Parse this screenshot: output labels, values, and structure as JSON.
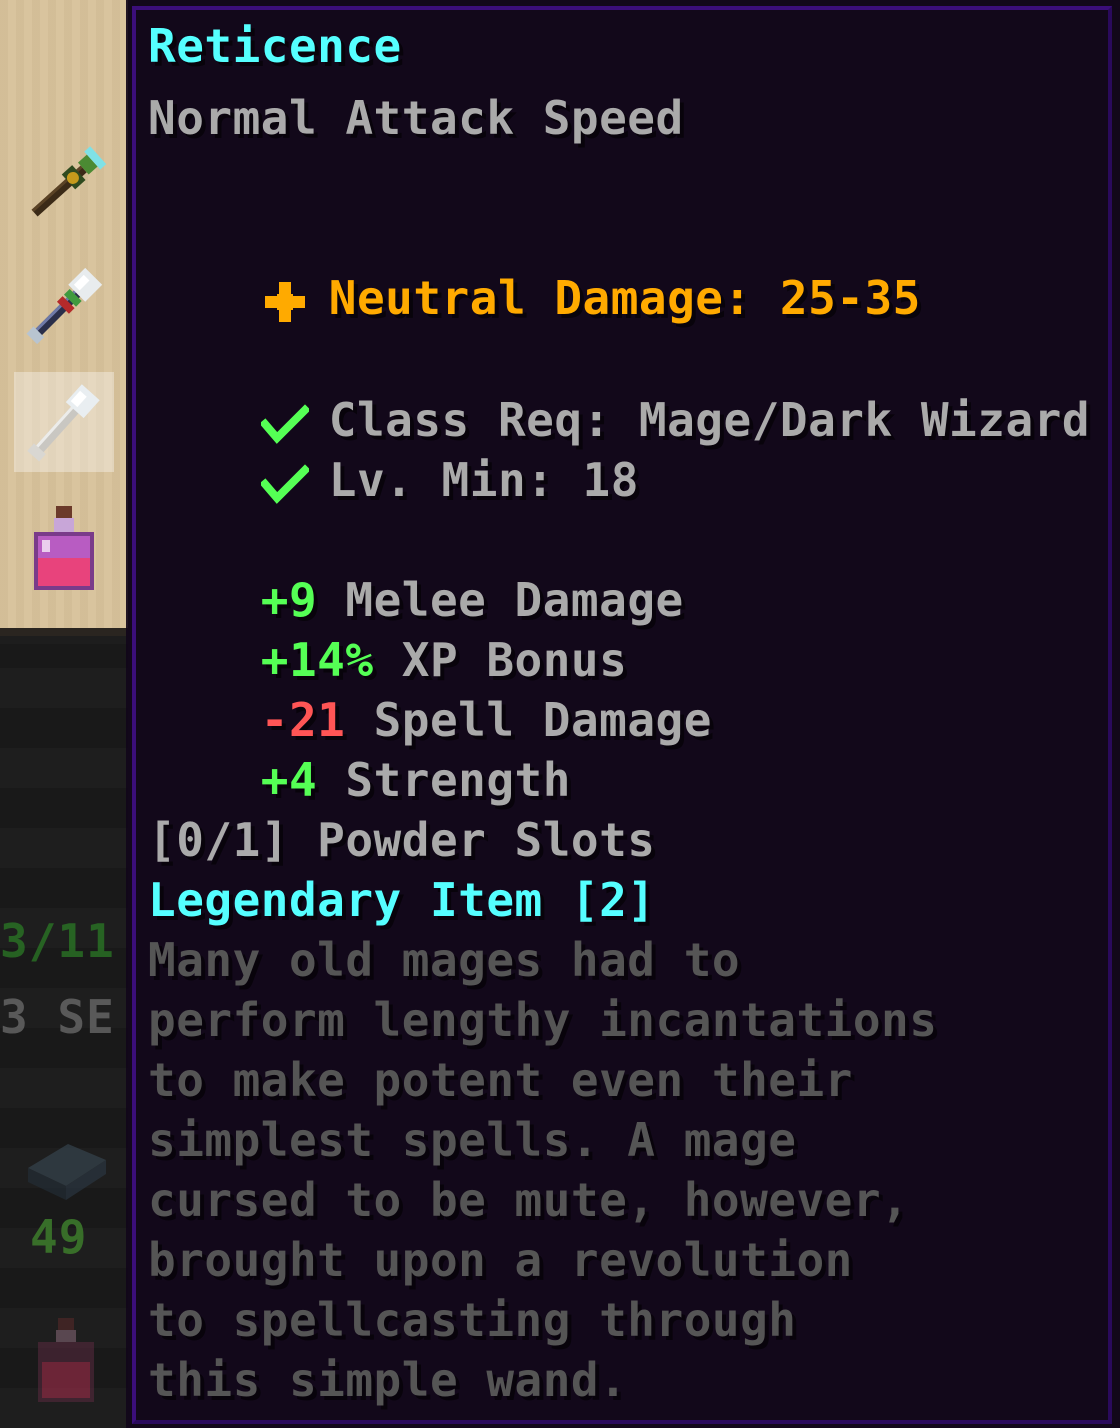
{
  "inventory": {
    "side_count": "3/11",
    "side_direction": "3 SE",
    "side_number": "49"
  },
  "item": {
    "name": "Reticence",
    "attack_speed": "Normal Attack Speed",
    "damage_label": "Neutral Damage: 25-35",
    "requirements": [
      {
        "text": "Class Req: Mage/Dark Wizard",
        "met": true
      },
      {
        "text": "Lv. Min: 18",
        "met": true
      }
    ],
    "identifications": [
      {
        "value": "+9",
        "label": "Melee Damage",
        "positive": true
      },
      {
        "value": "+14%",
        "label": "XP Bonus",
        "positive": true
      },
      {
        "value": "-21",
        "label": "Spell Damage",
        "positive": false
      },
      {
        "value": "+4",
        "label": "Strength",
        "positive": true
      }
    ],
    "powder_slots": "[0/1] Powder Slots",
    "rarity": "Legendary Item [2]",
    "lore": [
      "Many old mages had to",
      "perform lengthy incantations",
      "to make potent even their",
      "simplest spells. A mage",
      "cursed to be mute, however,",
      "brought upon a revolution",
      "to spellcasting through",
      "this simple wand."
    ]
  },
  "colors": {
    "name": "#55ffff",
    "damage": "#ffaa00",
    "positive": "#55ff55",
    "negative": "#ff5555",
    "lore": "#555555",
    "tooltip_bg": "#11061a",
    "tooltip_border": "#2a0a5c"
  },
  "icons": [
    "wand-icon",
    "relic-wand-icon",
    "bone-wand-icon",
    "potion-icon",
    "book-icon",
    "neutral-damage-icon",
    "checkmark-icon"
  ]
}
